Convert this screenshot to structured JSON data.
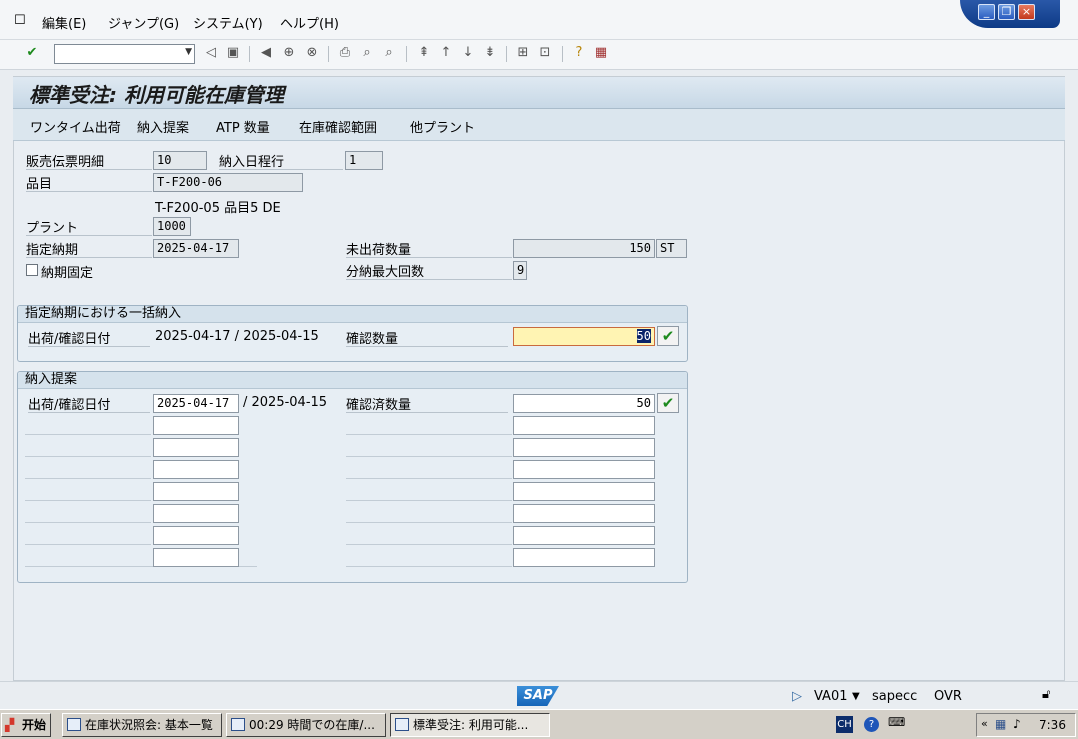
{
  "menu": {
    "items": [
      "編集(E)",
      "ジャンプ(G)",
      "システム(Y)",
      "ヘルプ(H)"
    ]
  },
  "toolbar": {
    "command_value": ""
  },
  "title": "標準受注: 利用可能在庫管理",
  "app_toolbar": [
    "ワンタイム出荷",
    "納入提案",
    "ATP 数量",
    "在庫確認範囲",
    "他プラント"
  ],
  "header": {
    "item_label": "販売伝票明細",
    "item_value": "10",
    "schedule_label": "納入日程行",
    "schedule_value": "1",
    "material_label": "品目",
    "material_value": "T-F200-06",
    "material_desc": "T-F200-05  品目5 DE",
    "plant_label": "プラント",
    "plant_value": "1000",
    "req_date_label": "指定納期",
    "req_date_value": "2025-04-17",
    "open_qty_label": "未出荷数量",
    "open_qty_value": "150",
    "open_qty_unit": "ST",
    "fixed_date_label": "納期固定",
    "max_partial_label": "分納最大回数",
    "max_partial_value": "9"
  },
  "group1": {
    "title": "指定納期における一括納入",
    "date_label": "出荷/確認日付",
    "dates": "2025-04-17 / 2025-04-15",
    "qty_label": "確認数量",
    "qty_value": "50"
  },
  "group2": {
    "title": "納入提案",
    "date_label": "出荷/確認日付",
    "date_value": "2025-04-17",
    "second_date": "/ 2025-04-15",
    "qty_label": "確認済数量",
    "qty_value": "50"
  },
  "status": {
    "transaction": "VA01",
    "system": "sapecc",
    "mode": "OVR"
  },
  "taskbar": {
    "start": "开始",
    "tasks": [
      "在庫状況照会: 基本一覧",
      "00:29 時間での在庫/...",
      "標準受注: 利用可能..."
    ],
    "lang": "CH",
    "clock": "7:36"
  }
}
